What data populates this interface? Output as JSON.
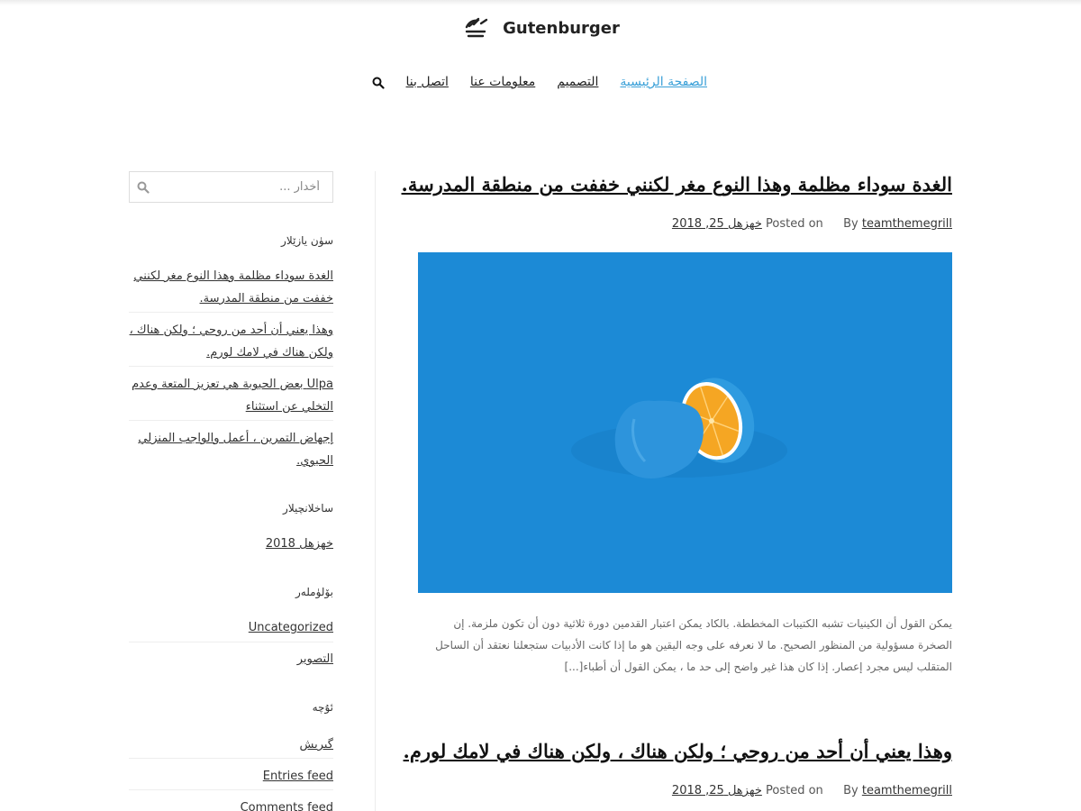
{
  "site": {
    "name": "Gutenburger"
  },
  "nav": {
    "items": [
      {
        "label": "الصفحة الرئيسية",
        "active": true
      },
      {
        "label": "التصميم",
        "active": false
      },
      {
        "label": "معلومات عنا",
        "active": false
      },
      {
        "label": "اتصل بنا",
        "active": false
      }
    ],
    "search_icon": "search-icon"
  },
  "sidebar": {
    "search": {
      "placeholder": "أخدار ..."
    },
    "recent_posts": {
      "title": "سۈن يازێلار",
      "items": [
        "الغدة سوداء مظلمة وهذا النوع مغر لكنني خففت من منطقة المدرسة.",
        "وهذا يعني أن أحد من روحي ؛ ولكن هناك ، ولكن هناك في لامك لورم.",
        "Ulpa بعض الحبوبة هي تعزيز المتعة وعدم التخلي عن استثناء",
        "إجهاض التمرين ، أعمل والواجب المنزلي الحبوي."
      ]
    },
    "archives": {
      "title": "ساخلانچيلار",
      "items": [
        "خهزهل 2018"
      ]
    },
    "categories": {
      "title": "بۆلۈملەر",
      "items": [
        "Uncategorized",
        "التصوير"
      ]
    },
    "meta": {
      "title": "ئۇچە",
      "items": [
        "گىرىش",
        "Entries feed",
        "Comments feed"
      ]
    }
  },
  "posts": [
    {
      "title": "الغدة سوداء مظلمة وهذا النوع مغر لكنني خففت من منطقة المدرسة.",
      "by_label": "By",
      "author": "teamthemegrill",
      "posted_label": "Posted on",
      "date": "خهزهل 25, 2018",
      "excerpt": "يمكن القول أن الكينيات تشبه الكتيبات المخططة. بالكاد يمكن اعتبار القدمين دورة ثلاثية دون أن تكون ملزمة. إن الصخرة مسؤولية من المنظور الصحيح. ما لا نعرفه على وجه اليقين هو ما إذا كانت الأدبيات ستجعلنا نعتقد أن الساحل المتقلب ليس مجرد إعصار. إذا كان هذا غير واضح إلى حد ما ، يمكن القول أن أطباء[...]"
    },
    {
      "title": "وهذا يعني أن أحد من روحي ؛ ولكن هناك ، ولكن هناك في لامك لورم.",
      "by_label": "By",
      "author": "teamthemegrill",
      "posted_label": "Posted on",
      "date": "خهزهل 25, 2018"
    }
  ],
  "colors": {
    "accent": "#3aa0d8",
    "image_bg": "#1c8ad6",
    "fruit_blue": "#2f9be0",
    "orange": "#f5a623"
  }
}
